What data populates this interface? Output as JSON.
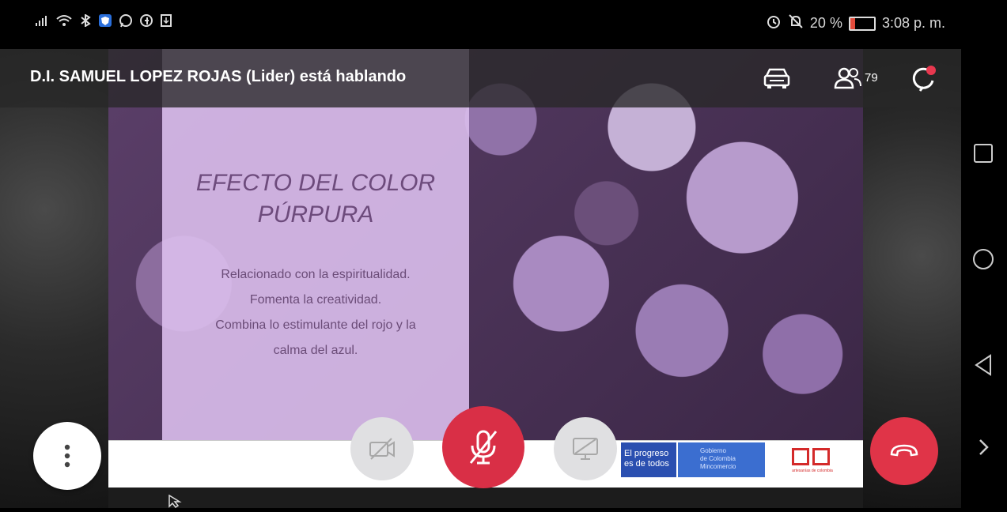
{
  "status_bar": {
    "time": "3:08 p. m.",
    "battery": "20 %",
    "battery_level": 0.2,
    "left_icons": [
      "signal-icon",
      "wifi-icon",
      "bluetooth-icon",
      "shield-app-icon",
      "whatsapp-icon",
      "facebook-icon",
      "notification-icon"
    ],
    "right_icons": [
      "alarm-icon",
      "silent-icon",
      "battery-icon"
    ]
  },
  "call": {
    "speaker_text": "D.I. SAMUEL LOPEZ ROJAS (Lider) está hablando",
    "participants_count": "79"
  },
  "slide": {
    "title_line1": "EFECTO DEL COLOR",
    "title_line2": "PÚRPURA",
    "body": [
      "Relacionado con la espiritualidad.",
      "Fomenta la creatividad.",
      "Combina lo estimulante del rojo y la",
      "calma del azul."
    ],
    "footer_gov1_line1": "El progreso",
    "footer_gov1_line2": "es de todos",
    "footer_gov2_line1": "Gobierno",
    "footer_gov2_line2": "de Colombia",
    "footer_gov2_line3": "Mincomercio",
    "logo_caption": "artesanías de colombia"
  },
  "controls": {
    "menu": "more-options",
    "camera": "camera-off",
    "mic": "mic-muted",
    "share": "screen-share-off",
    "end": "end-call"
  },
  "colors": {
    "mic_red": "#d92f46",
    "end_red": "#e03448",
    "panel_purple": "#dabeec",
    "title_purple": "#6d4b7c"
  }
}
